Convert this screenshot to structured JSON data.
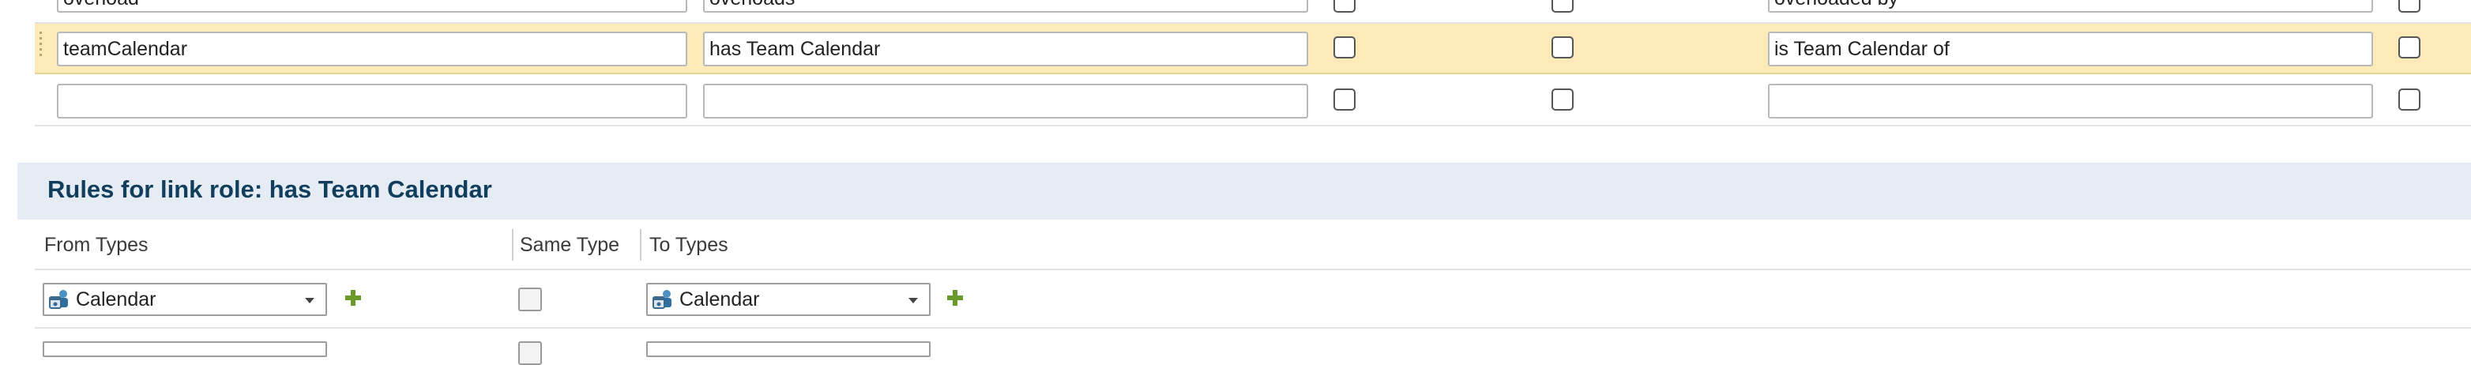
{
  "link_roles": {
    "rows": [
      {
        "name": "overload",
        "forward_label": "overloads",
        "reverse_label": "overloaded by"
      },
      {
        "name": "teamCalendar",
        "forward_label": "has Team Calendar",
        "reverse_label": "is Team Calendar of"
      },
      {
        "name": "",
        "forward_label": "",
        "reverse_label": ""
      }
    ]
  },
  "rules": {
    "title": "Rules for link role: has Team Calendar",
    "columns": {
      "from_types": "From Types",
      "same_type": "Same Type",
      "to_types": "To Types"
    },
    "rows": [
      {
        "from_type": "Calendar",
        "to_type": "Calendar"
      }
    ]
  },
  "colors": {
    "highlight_row": "#fcebb8",
    "header_band": "#e5ecf3",
    "title": "#123e5e",
    "plus_icon": "#6a9a2a"
  }
}
